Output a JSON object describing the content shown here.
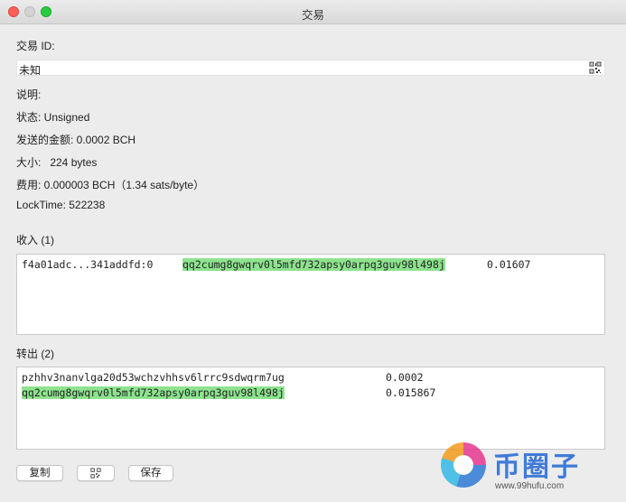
{
  "window": {
    "title": "交易"
  },
  "fields": {
    "txid_label": "交易 ID:",
    "txid_value": "未知",
    "description_label": "说明:",
    "status": "状态: Unsigned",
    "amount_sent": "发送的金额: 0.0002 BCH",
    "size": "大小:   224 bytes",
    "fee": "费用: 0.000003 BCH（1.34 sats/byte）",
    "locktime": "LockTime: 522238"
  },
  "inputs": {
    "header": "收入 (1)",
    "rows": [
      {
        "prevout": "f4a01adc...341addfd:0",
        "address": "qq2cumg8gwqrv0l5mfd732apsy0arpq3guv98l498j",
        "amount": "0.01607"
      }
    ]
  },
  "outputs": {
    "header": "转出 (2)",
    "rows": [
      {
        "address": "pzhhv3nanvlga20d53wchzvhhsv6lrrc9sdwqrm7ug",
        "amount": "0.0002"
      },
      {
        "address": "qq2cumg8gwqrv0l5mfd732apsy0arpq3guv98l498j",
        "amount": "0.015867"
      }
    ]
  },
  "buttons": {
    "copy": "复制",
    "save": "保存"
  },
  "icons": {
    "qr": "qr-code-icon"
  },
  "colors": {
    "address_highlight": "#8de38e",
    "close": "#fe5f57",
    "maximize": "#2acb42"
  },
  "watermark": {
    "text": "币圈子",
    "url": "www.99hufu.com"
  }
}
